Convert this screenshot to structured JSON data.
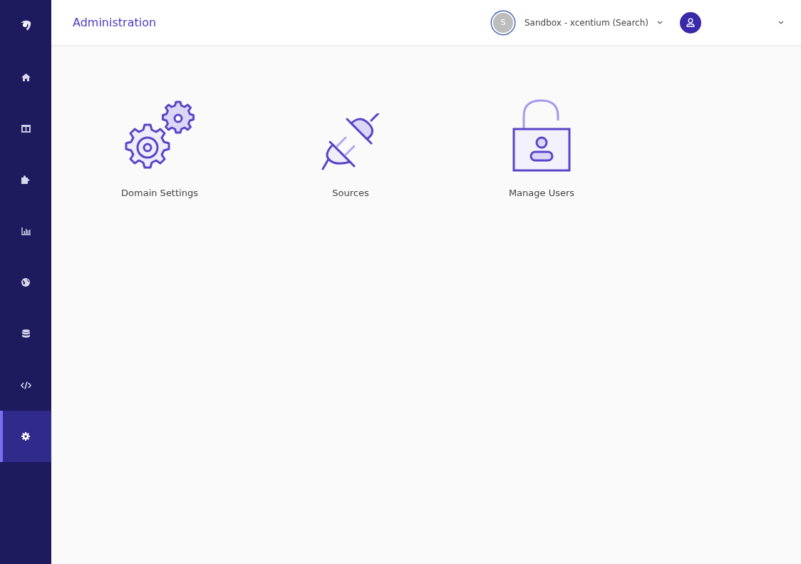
{
  "sidebar": {
    "items": [
      {
        "kind": "home",
        "selected": false
      },
      {
        "kind": "columns",
        "selected": false
      },
      {
        "kind": "puzzle",
        "selected": false
      },
      {
        "kind": "chart",
        "selected": false
      },
      {
        "kind": "globe",
        "selected": false
      },
      {
        "kind": "database",
        "selected": false
      },
      {
        "kind": "code",
        "selected": false
      },
      {
        "kind": "gear",
        "selected": true
      }
    ]
  },
  "header": {
    "title": "Administration",
    "workspace": {
      "initial": "S",
      "name": "Sandbox - xcentium (Search)"
    }
  },
  "tiles": [
    {
      "kind": "gears",
      "label": "Domain Settings"
    },
    {
      "kind": "plug",
      "label": "Sources"
    },
    {
      "kind": "lock",
      "label": "Manage Users"
    }
  ]
}
